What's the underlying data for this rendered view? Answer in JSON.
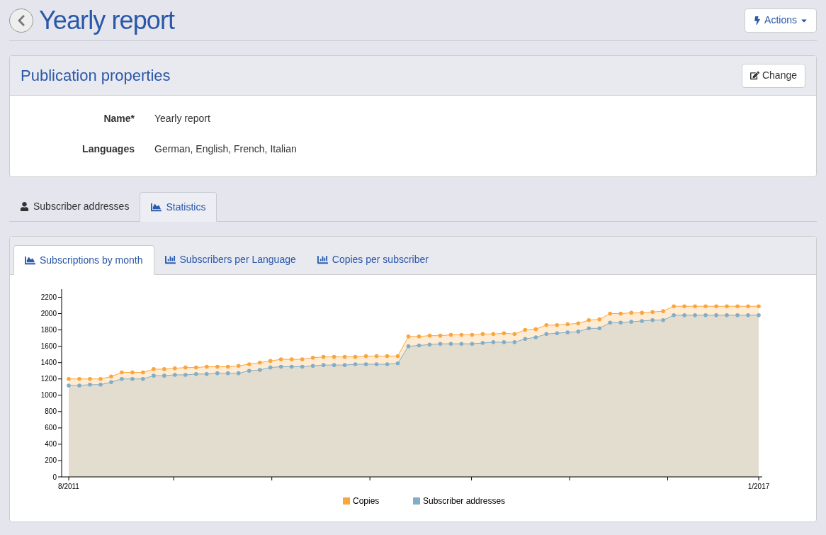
{
  "page": {
    "title": "Yearly report",
    "actions_button": "Actions"
  },
  "properties_panel": {
    "title": "Publication properties",
    "change_button": "Change",
    "fields": [
      {
        "label": "Name*",
        "value": "Yearly report"
      },
      {
        "label": "Languages",
        "value": "German, English, French, Italian"
      }
    ]
  },
  "tabs": [
    {
      "label": "Subscriber addresses",
      "kind": "list",
      "selected": false
    },
    {
      "label": "Statistics",
      "kind": "chart",
      "selected": true
    }
  ],
  "statistics_panel": {
    "tabs": [
      {
        "label": "Subscriptions by month",
        "kind": "area",
        "selected": true
      },
      {
        "label": "Subscribers per Language",
        "kind": "bar",
        "selected": false
      },
      {
        "label": "Copies per subscriber",
        "kind": "bar",
        "selected": false
      }
    ],
    "chart_data": {
      "type": "area",
      "legend": "bottom",
      "categories": [
        "8/2011",
        null,
        null,
        null,
        null,
        null,
        null,
        null,
        null,
        null,
        null,
        null,
        null,
        null,
        null,
        null,
        null,
        null,
        null,
        null,
        null,
        null,
        null,
        null,
        null,
        null,
        null,
        null,
        null,
        null,
        null,
        null,
        null,
        null,
        null,
        null,
        null,
        null,
        null,
        null,
        null,
        null,
        null,
        null,
        null,
        null,
        null,
        null,
        null,
        null,
        null,
        null,
        null,
        null,
        null,
        null,
        null,
        null,
        null,
        null,
        null,
        null,
        null,
        null,
        null,
        "1/2017"
      ],
      "ylim": [
        0,
        2300
      ],
      "yticks": [
        0,
        200,
        400,
        600,
        800,
        1000,
        1200,
        1400,
        1600,
        1800,
        2000,
        2200
      ],
      "stacked": false,
      "series": [
        {
          "name": "Copies",
          "color": "#fba63c",
          "values": [
            1200,
            1200,
            1200,
            1200,
            1230,
            1280,
            1280,
            1280,
            1320,
            1320,
            1330,
            1340,
            1340,
            1350,
            1350,
            1350,
            1360,
            1380,
            1400,
            1420,
            1440,
            1440,
            1440,
            1460,
            1470,
            1470,
            1470,
            1470,
            1480,
            1480,
            1480,
            1480,
            1720,
            1720,
            1730,
            1730,
            1740,
            1740,
            1740,
            1750,
            1750,
            1760,
            1750,
            1800,
            1810,
            1860,
            1860,
            1870,
            1880,
            1920,
            1930,
            2000,
            2000,
            2010,
            2010,
            2020,
            2030,
            2090,
            2090,
            2090,
            2090,
            2090,
            2090,
            2090,
            2090,
            2090
          ]
        },
        {
          "name": "Subscriber addresses",
          "color": "#83adc6",
          "values": [
            1120,
            1120,
            1130,
            1130,
            1160,
            1200,
            1200,
            1200,
            1240,
            1240,
            1250,
            1250,
            1260,
            1260,
            1270,
            1270,
            1270,
            1300,
            1310,
            1340,
            1350,
            1350,
            1350,
            1360,
            1370,
            1370,
            1370,
            1380,
            1380,
            1380,
            1380,
            1390,
            1600,
            1610,
            1620,
            1630,
            1630,
            1630,
            1630,
            1640,
            1650,
            1650,
            1650,
            1690,
            1710,
            1750,
            1760,
            1770,
            1780,
            1820,
            1820,
            1890,
            1890,
            1900,
            1910,
            1920,
            1920,
            1980,
            1980,
            1980,
            1980,
            1980,
            1980,
            1980,
            1980,
            1980
          ]
        }
      ]
    }
  }
}
